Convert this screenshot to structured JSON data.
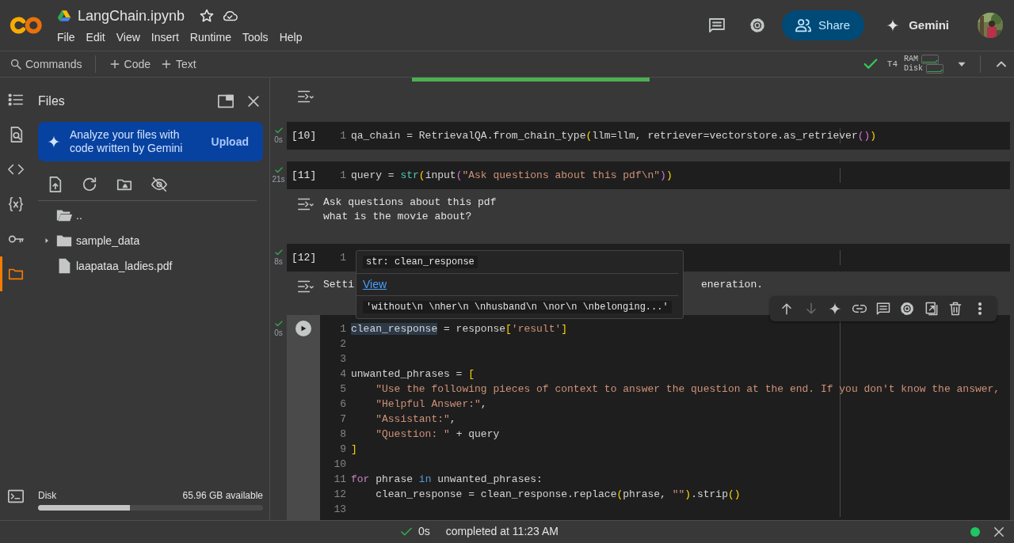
{
  "app": {
    "title": "LangChain.ipynb",
    "starred": false,
    "menu": [
      "File",
      "Edit",
      "View",
      "Insert",
      "Runtime",
      "Tools",
      "Help"
    ]
  },
  "header_actions": {
    "share": "Share",
    "gemini": "Gemini"
  },
  "toolbar": {
    "commands": "Commands",
    "add": [
      "Code",
      "Text"
    ]
  },
  "runtime": {
    "connected": true,
    "accelerator": "T4",
    "ram": "RAM",
    "disk": "Disk"
  },
  "rail": [
    {
      "kind": "toc",
      "selected": false
    },
    {
      "kind": "find",
      "selected": false
    },
    {
      "kind": "snippets",
      "selected": false
    },
    {
      "kind": "variables",
      "selected": false
    },
    {
      "kind": "secrets",
      "selected": false
    },
    {
      "kind": "files",
      "selected": true
    }
  ],
  "files_panel": {
    "title": "Files",
    "banner": {
      "text": "Analyze your files with code written by Gemini",
      "action": "Upload"
    },
    "tree": [
      {
        "name": "..",
        "kind": "parent"
      },
      {
        "name": "sample_data",
        "kind": "folder",
        "expanded": false
      },
      {
        "name": "laapataa_ladies.pdf",
        "kind": "file"
      }
    ],
    "disk": {
      "label": "Disk",
      "reading": "65.96 GB available",
      "level": 0.41
    }
  },
  "cells": [
    {
      "kind": "output",
      "progress": {
        "level": 1
      }
    },
    {
      "kind": "code",
      "count": "[10]",
      "done": true,
      "duration": "0s",
      "active": false,
      "lines": [
        {
          "n": "1",
          "tokens": [
            {
              "text": "qa_chain = RetrievalQA.from_chain_type",
              "kind": "plain"
            },
            {
              "text": "(",
              "kind": "bracket"
            },
            {
              "text": "llm=llm, retriever=vectorstore.as_retriever",
              "kind": "plain"
            },
            {
              "text": "()",
              "kind": "bracket2"
            },
            {
              "text": ")",
              "kind": "bracket"
            }
          ]
        }
      ]
    },
    {
      "kind": "code",
      "count": "[11]",
      "done": true,
      "duration": "21s",
      "active": false,
      "lines": [
        {
          "n": "1",
          "tokens": [
            {
              "text": "query = ",
              "kind": "plain"
            },
            {
              "text": "str",
              "kind": "builtin"
            },
            {
              "text": "(",
              "kind": "bracket"
            },
            {
              "text": "input",
              "kind": "plain"
            },
            {
              "text": "(",
              "kind": "bracket2"
            },
            {
              "text": "\"Ask questions about this pdf\\n\"",
              "kind": "string"
            },
            {
              "text": ")",
              "kind": "bracket2"
            },
            {
              "text": ")",
              "kind": "bracket"
            }
          ]
        }
      ],
      "output": [
        "Ask questions about this pdf",
        "what is the movie about?"
      ]
    },
    {
      "kind": "code",
      "count": "[12]",
      "done": true,
      "duration": "8s",
      "active": false,
      "lines": [
        {
          "n": "1"
        }
      ],
      "output_parts": [
        "Setti",
        "eneration."
      ],
      "tooltip": {
        "type": "str: clean_response",
        "link": "View",
        "value": "'without\\n \\nher\\n \\nhusband\\n \\nor\\n \\nbelonging...'"
      }
    },
    {
      "kind": "code",
      "done": true,
      "duration": "0s",
      "active": true,
      "toolbar": [
        {
          "kind": "up",
          "disabled": false
        },
        {
          "kind": "down",
          "disabled": true
        },
        {
          "kind": "gemini",
          "disabled": false
        },
        {
          "kind": "link",
          "disabled": false
        },
        {
          "kind": "comment",
          "disabled": false
        },
        {
          "kind": "settings",
          "disabled": false
        },
        {
          "kind": "mirror",
          "disabled": false
        },
        {
          "kind": "delete",
          "disabled": false
        },
        {
          "kind": "more",
          "disabled": false
        }
      ],
      "lines": [
        {
          "n": "1",
          "tokens": [
            {
              "text": "clean_response",
              "kind": "highlight"
            },
            {
              "text": " = response",
              "kind": "plain"
            },
            {
              "text": "[",
              "kind": "bracket"
            },
            {
              "text": "'result'",
              "kind": "string"
            },
            {
              "text": "]",
              "kind": "bracket"
            }
          ]
        },
        {
          "n": "2"
        },
        {
          "n": "3"
        },
        {
          "n": "4",
          "tokens": [
            {
              "text": "unwanted_phrases = ",
              "kind": "plain"
            },
            {
              "text": "[",
              "kind": "bracket"
            }
          ]
        },
        {
          "n": "5",
          "tokens": [
            {
              "text": "    \"Use the following pieces of context to answer the question at the end. If you don't know the answer,",
              "kind": "string"
            }
          ]
        },
        {
          "n": "6",
          "tokens": [
            {
              "text": "    \"Helpful Answer:\"",
              "kind": "string"
            },
            {
              "text": ",",
              "kind": "plain"
            }
          ]
        },
        {
          "n": "7",
          "tokens": [
            {
              "text": "    \"Assistant:\"",
              "kind": "string"
            },
            {
              "text": ",",
              "kind": "plain"
            }
          ]
        },
        {
          "n": "8",
          "tokens": [
            {
              "text": "    \"Question: \"",
              "kind": "string"
            },
            {
              "text": " + query",
              "kind": "plain"
            }
          ]
        },
        {
          "n": "9",
          "tokens": [
            {
              "text": "]",
              "kind": "bracket"
            }
          ]
        },
        {
          "n": "10"
        },
        {
          "n": "11",
          "tokens": [
            {
              "text": "for",
              "kind": "keyword"
            },
            {
              "text": " phrase ",
              "kind": "plain"
            },
            {
              "text": "in",
              "kind": "operator"
            },
            {
              "text": " unwanted_phrases:",
              "kind": "plain"
            }
          ]
        },
        {
          "n": "12",
          "tokens": [
            {
              "text": "    clean_response = clean_response.replace",
              "kind": "plain"
            },
            {
              "text": "(",
              "kind": "bracket"
            },
            {
              "text": "phrase, ",
              "kind": "plain"
            },
            {
              "text": "\"\"",
              "kind": "string"
            },
            {
              "text": ")",
              "kind": "bracket"
            },
            {
              "text": ".strip",
              "kind": "plain"
            },
            {
              "text": "()",
              "kind": "bracket"
            }
          ]
        },
        {
          "n": "13"
        }
      ]
    }
  ],
  "status_bar": {
    "duration": "0s",
    "text": "completed at 11:23 AM",
    "connected": true
  }
}
